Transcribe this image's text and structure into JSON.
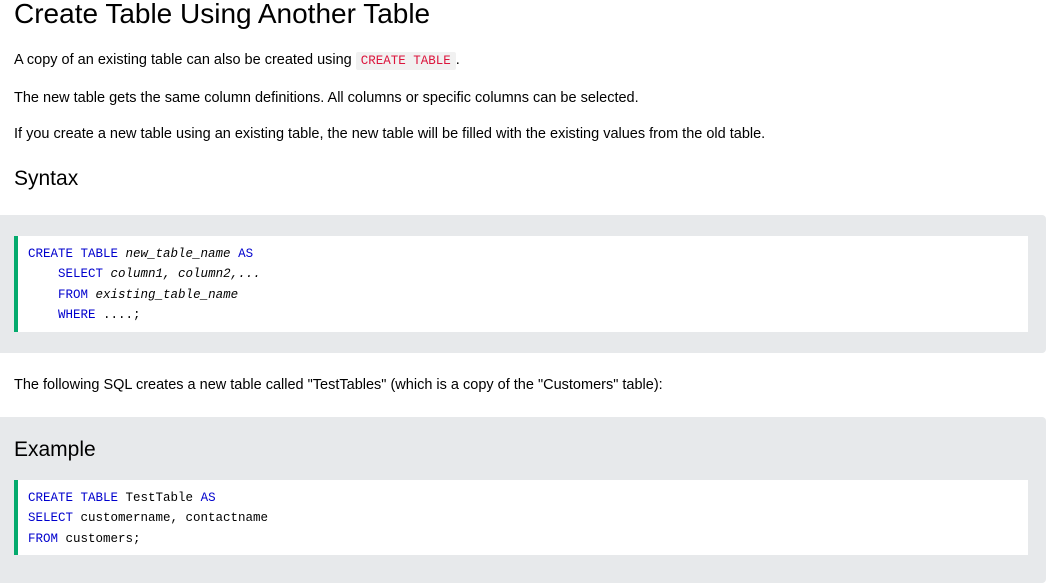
{
  "title": "Create Table Using Another Table",
  "paragraphs": {
    "p1_text": "A copy of an existing table can also be created using ",
    "p1_code": "CREATE TABLE",
    "p1_end": ".",
    "p2": "The new table gets the same column definitions. All columns or specific columns can be selected.",
    "p3": "If you create a new table using an existing table, the new table will be filled with the existing values from the old table.",
    "p4": "The following SQL creates a new table called \"TestTables\" (which is a copy of the \"Customers\" table):"
  },
  "syntax": {
    "heading": "Syntax",
    "lines": [
      {
        "indent": "",
        "keyword": "CREATE TABLE",
        "rest": "new_table_name",
        "keyword2": "AS"
      },
      {
        "indent": "    ",
        "keyword": "SELECT",
        "rest": "column1, column2,..."
      },
      {
        "indent": "    ",
        "keyword": "FROM",
        "rest": "existing_table_name"
      },
      {
        "indent": "    ",
        "keyword": "WHERE",
        "rest": "....;"
      }
    ]
  },
  "example": {
    "heading": "Example",
    "lines": [
      {
        "keyword": "CREATE TABLE",
        "rest": "TestTable",
        "keyword2": "AS"
      },
      {
        "keyword": "SELECT",
        "rest": "customername, contactname"
      },
      {
        "keyword": "FROM",
        "rest": "customers;"
      }
    ]
  },
  "colors": {
    "keyword": "#0000cd",
    "inline_code": "#dc143c",
    "code_border": "#04aa6d",
    "panel_bg": "#e7e9eb"
  }
}
